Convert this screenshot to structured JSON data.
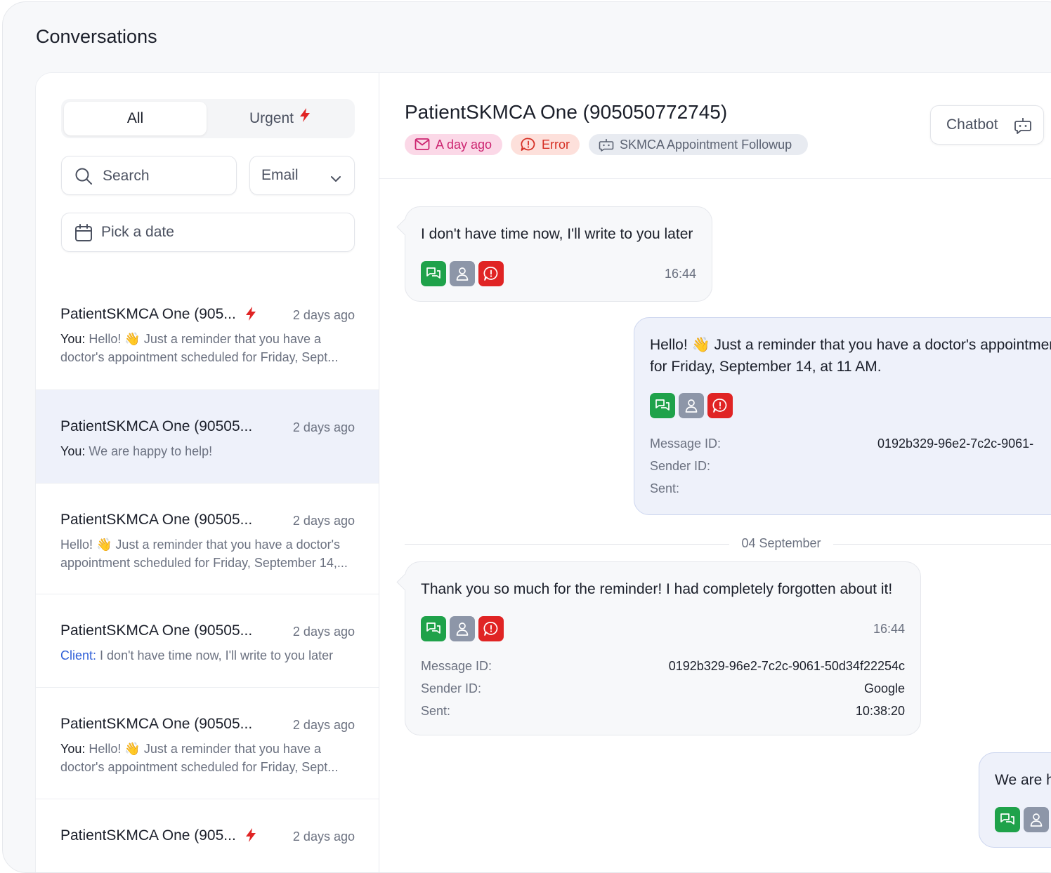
{
  "page": {
    "title": "Conversations"
  },
  "tabs": {
    "all": "All",
    "urgent": "Urgent"
  },
  "filters": {
    "search_placeholder": "Search",
    "channel": "Email",
    "date_placeholder": "Pick a date"
  },
  "conversations": [
    {
      "name": "PatientSKMCA One (905...",
      "time": "2 days ago",
      "urgent": true,
      "sender": "You:",
      "line1": "Hello! 👋 Just a reminder that you have a",
      "line2": "doctor's appointment scheduled for Friday, Sept..."
    },
    {
      "name": "PatientSKMCA One (90505...",
      "time": "2 days ago",
      "urgent": false,
      "sender": "You:",
      "line1": "We are happy to help!"
    },
    {
      "name": "PatientSKMCA One (90505...",
      "time": "2 days ago",
      "urgent": false,
      "sender": "",
      "line1": "Hello! 👋 Just a reminder that you have a doctor's",
      "line2": "appointment scheduled for Friday, September 14,..."
    },
    {
      "name": "PatientSKMCA One (90505...",
      "time": "2 days ago",
      "urgent": false,
      "sender": "Client:",
      "line1": "I don't have time now, I'll write to you later"
    },
    {
      "name": "PatientSKMCA One (90505...",
      "time": "2 days ago",
      "urgent": false,
      "sender": "You:",
      "line1": "Hello! 👋 Just a reminder that you have a",
      "line2": "doctor's appointment scheduled for Friday, Sept..."
    },
    {
      "name": "PatientSKMCA One (905...",
      "time": "2 days ago",
      "urgent": true
    }
  ],
  "chat": {
    "title": "PatientSKMCA One (905050772745)",
    "badges": {
      "time": "A day ago",
      "status": "Error",
      "flow": "SKMCA Appointment Followup"
    },
    "chatbot_label": "Chatbot",
    "meta_labels": {
      "message_id": "Message ID:",
      "sender_id": "Sender ID:",
      "sent": "Sent:"
    },
    "messages": [
      {
        "direction": "in",
        "text": "I don't have time now, I'll write to you later",
        "time": "16:44"
      },
      {
        "direction": "out",
        "line1": "Hello! 👋 Just a reminder that you have a doctor's appointment",
        "line2": "for Friday, September 14, at 11 AM.",
        "message_id": "0192b329-96e2-7c2c-9061-"
      },
      {
        "direction": "in",
        "text": "Thank you so much for the reminder! I had completely forgotten about it!",
        "time": "16:44",
        "message_id": "0192b329-96e2-7c2c-9061-50d34f22254c",
        "sender_id": "Google",
        "sent": "10:38:20"
      },
      {
        "direction": "out",
        "text": "We are h"
      }
    ],
    "date_divider": "04 September"
  },
  "colors": {
    "accent_green": "#1fa24a",
    "accent_gray": "#8d96a8",
    "accent_red": "#e02424",
    "urgent_bolt": "#e02424",
    "client_label": "#2f5fd8",
    "active_row": "#eef1fa"
  },
  "icons": {
    "urgent": "lightning-bolt-icon",
    "search": "magnifier-icon",
    "date": "calendar-icon",
    "dropdown": "chevron-down-icon",
    "time_badge": "envelope-icon",
    "error_badge": "message-alert-icon",
    "flow_badge": "bot-icon",
    "chatbot": "bot-message-icon",
    "actions": [
      "chat-bubbles-icon",
      "user-icon",
      "alert-icon"
    ]
  }
}
